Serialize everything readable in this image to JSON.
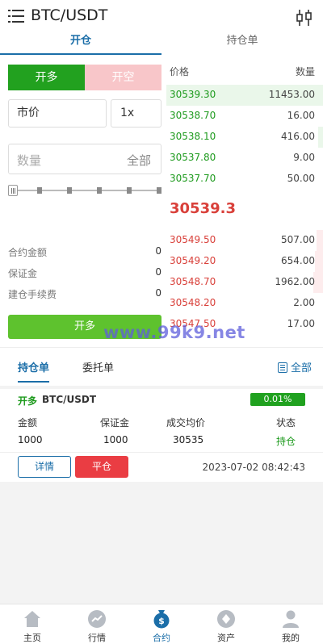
{
  "header": {
    "title": "BTC/USDT",
    "menu_icon": "menu-icon",
    "filter_icon": "candlestick-icon"
  },
  "tabs": [
    {
      "label": "开仓"
    },
    {
      "label": "持仓单"
    }
  ],
  "order_form": {
    "long_label": "开多",
    "short_label": "开空",
    "price_type": "市价",
    "leverage": "1x",
    "quantity_placeholder": "数量",
    "quantity_all": "全部",
    "slider_percent": 0,
    "contract_amount_label": "合约金额",
    "contract_amount_value": "0",
    "margin_label": "保证金",
    "margin_value": "0",
    "fee_label": "建仓手续费",
    "fee_value": "0",
    "submit_label": "开多"
  },
  "orderbook": {
    "price_header": "价格",
    "qty_header": "数量",
    "buys": [
      {
        "price": "30539.30",
        "qty": "11453.00"
      },
      {
        "price": "30538.70",
        "qty": "16.00"
      },
      {
        "price": "30538.10",
        "qty": "416.00"
      },
      {
        "price": "30537.80",
        "qty": "9.00"
      },
      {
        "price": "30537.70",
        "qty": "50.00"
      }
    ],
    "last_price": "30539.3",
    "sells": [
      {
        "price": "30549.50",
        "qty": "507.00"
      },
      {
        "price": "30549.20",
        "qty": "654.00"
      },
      {
        "price": "30548.70",
        "qty": "1962.00"
      },
      {
        "price": "30548.20",
        "qty": "2.00"
      },
      {
        "price": "30547.50",
        "qty": "17.00"
      }
    ]
  },
  "watermark": "www.99k9.net",
  "positions": {
    "tab_holding": "持仓单",
    "tab_orders": "委托单",
    "all_label": "全部",
    "card": {
      "side": "开多",
      "symbol": "BTC/USDT",
      "pnl_pct": "0.01%",
      "labels": [
        "金额",
        "保证金",
        "成交均价",
        "状态"
      ],
      "values": [
        "1000",
        "1000",
        "30535",
        "持仓"
      ],
      "detail_label": "详情",
      "close_label": "平仓",
      "time": "2023-07-02 08:42:43"
    }
  },
  "bottom_nav": [
    {
      "label": "主页",
      "icon": "home-icon"
    },
    {
      "label": "行情",
      "icon": "market-icon"
    },
    {
      "label": "合约",
      "icon": "contract-icon"
    },
    {
      "label": "资产",
      "icon": "assets-icon"
    },
    {
      "label": "我的",
      "icon": "profile-icon"
    }
  ],
  "colors": {
    "accent": "#1b6ea8",
    "buy": "#22a11f",
    "sell": "#d9403a",
    "short_btn": "#f8c6c9",
    "submit": "#5ec22e",
    "close": "#ea3d43"
  }
}
